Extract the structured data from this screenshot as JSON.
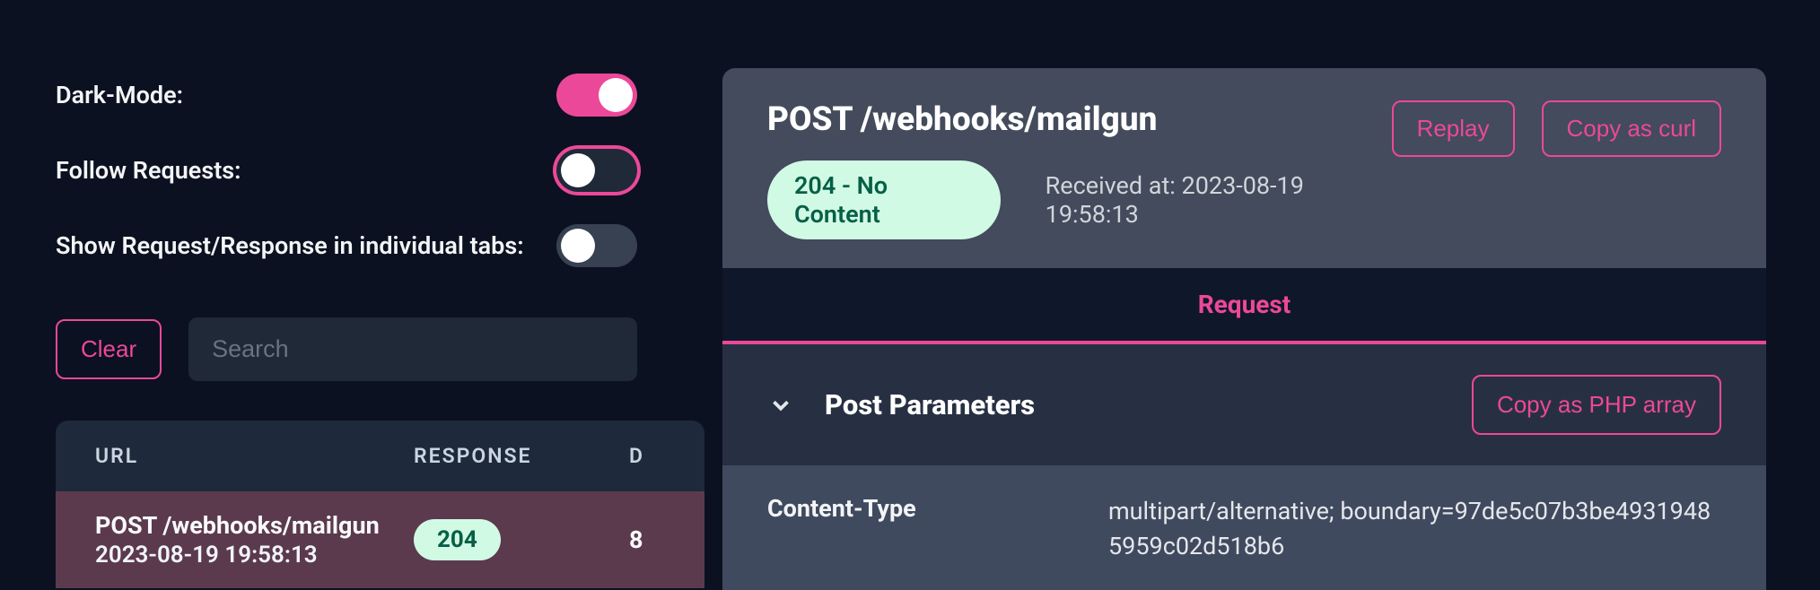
{
  "settings": {
    "darkmode_label": "Dark-Mode:",
    "follow_label": "Follow Requests:",
    "tabs_label": "Show Request/Response in individual tabs:"
  },
  "actions": {
    "clear": "Clear",
    "search_placeholder": "Search"
  },
  "table": {
    "head_url": "URL",
    "head_resp": "RESPONSE",
    "head_d": "D",
    "row": {
      "endpoint": "POST /webhooks/mailgun",
      "time": "2023-08-19 19:58:13",
      "status": "204",
      "d": "8"
    }
  },
  "detail": {
    "title": "POST /webhooks/mailgun",
    "status": "204 - No Content",
    "received": "Received at: 2023-08-19 19:58:13",
    "replay": "Replay",
    "copy_curl": "Copy as curl",
    "tab_request": "Request",
    "section_title": "Post Parameters",
    "copy_php": "Copy as PHP array",
    "kv_key": "Content-Type",
    "kv_val": "multipart/alternative; boundary=97de5c07b3be49319485959c02d518b6"
  }
}
